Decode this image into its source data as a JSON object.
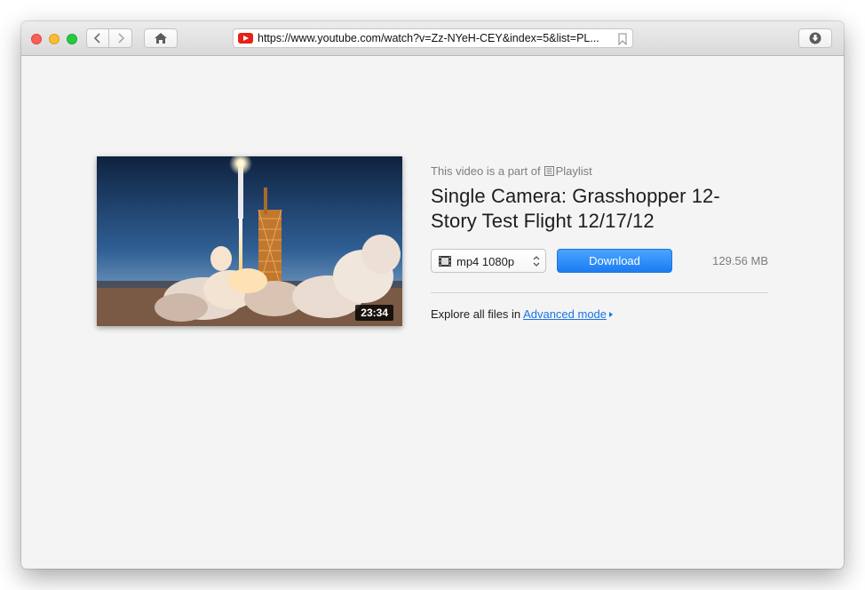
{
  "browser": {
    "url": "https://www.youtube.com/watch?v=Zz-NYeH-CEY&index=5&list=PL...",
    "favicon_icon": "youtube-icon",
    "back_icon": "chevron-left-icon",
    "forward_icon": "chevron-right-icon",
    "home_icon": "home-icon",
    "bookmark_icon": "bookmark-icon",
    "downloads_icon": "download-circle-icon"
  },
  "video": {
    "playlist_prefix": "This video is a part of",
    "playlist_label": "Playlist",
    "title": "Single Camera: Grasshopper 12-Story Test Flight 12/17/12",
    "duration": "23:34",
    "thumbnail_icon": "rocket-launch-thumbnail"
  },
  "download": {
    "format": "mp4 1080p",
    "button_label": "Download",
    "file_size": "129.56 MB"
  },
  "footer": {
    "explore_text": "Explore all files in",
    "advanced_link": "Advanced mode"
  },
  "colors": {
    "accent": "#1c7cf2",
    "link": "#1a73e8",
    "youtube_red": "#e62117"
  }
}
